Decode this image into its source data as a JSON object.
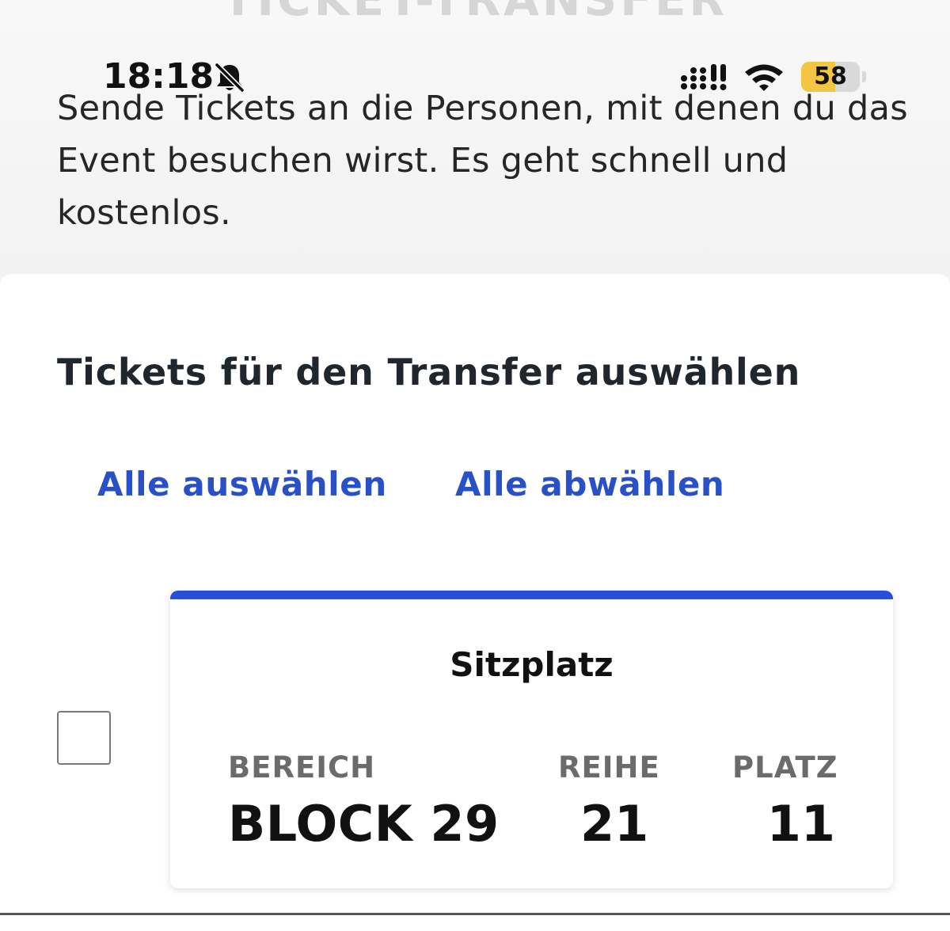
{
  "page": {
    "ghost_title": "TICKET-TRANSFER"
  },
  "status_bar": {
    "time": "18:18",
    "battery_level": "58",
    "battery_fraction": 0.58,
    "icons": [
      "bell-slash-icon",
      "signal-icon",
      "wifi-icon",
      "battery-icon"
    ],
    "battery_color": "#f4c542"
  },
  "intro": {
    "text": "Sende Tickets an die Personen, mit denen du das Event besuchen wirst. Es geht schnell und kostenlos."
  },
  "selection": {
    "heading": "Tickets für den Transfer auswählen",
    "select_all": "Alle auswählen",
    "deselect_all": "Alle abwählen"
  },
  "tickets": [
    {
      "checked": false,
      "type": "Sitzplatz",
      "area_label": "BEREICH",
      "area_value": "BLOCK 29",
      "row_label": "REIHE",
      "row_value": "21",
      "seat_label": "PLATZ",
      "seat_value": "11"
    }
  ],
  "colors": {
    "accent": "#2a4fd6",
    "link": "#2a50c8",
    "text": "#1f262d"
  }
}
